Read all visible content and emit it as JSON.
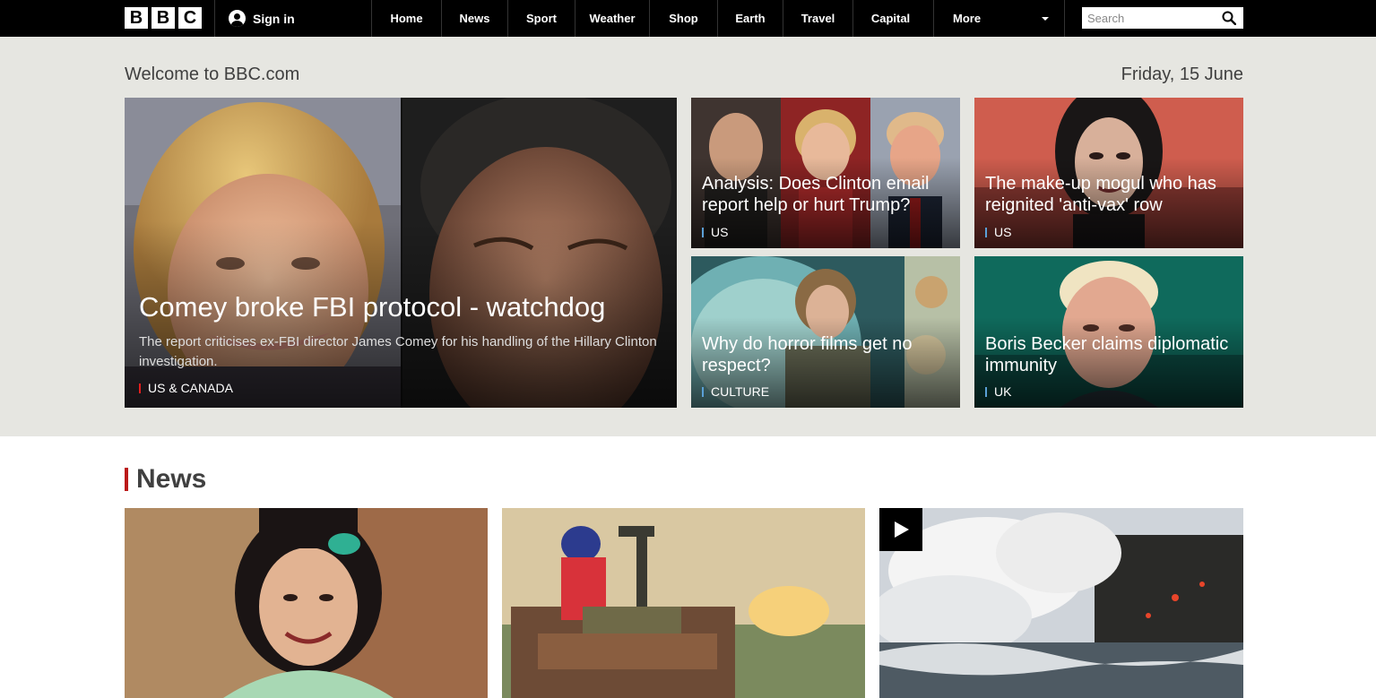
{
  "brand": {
    "logo_letters": [
      "B",
      "B",
      "C"
    ]
  },
  "nav": {
    "sign_in": "Sign in",
    "links": [
      {
        "label": "Home"
      },
      {
        "label": "News"
      },
      {
        "label": "Sport"
      },
      {
        "label": "Weather"
      },
      {
        "label": "Shop"
      },
      {
        "label": "Earth"
      },
      {
        "label": "Travel"
      },
      {
        "label": "Capital"
      }
    ],
    "more": "More",
    "search_placeholder": "Search"
  },
  "hero": {
    "welcome": "Welcome to BBC.com",
    "date": "Friday, 15 June",
    "main": {
      "headline": "Comey broke FBI protocol - watchdog",
      "summary": "The report criticises ex-FBI director James Comey for his handling of the Hillary Clinton investigation.",
      "tag": "US & CANADA"
    },
    "stories": [
      {
        "headline": "Analysis: Does Clinton email report help or hurt Trump?",
        "tag": "US"
      },
      {
        "headline": "The make-up mogul who has reignited 'anti-vax' row",
        "tag": "US"
      },
      {
        "headline": "Why do horror films get no respect?",
        "tag": "CULTURE"
      },
      {
        "headline": "Boris Becker claims diplomatic immunity",
        "tag": "UK"
      }
    ]
  },
  "news": {
    "title": "News"
  },
  "colors": {
    "nav_bg": "#000000",
    "band_bg": "#e6e6e1",
    "news_accent": "#bb1919"
  }
}
